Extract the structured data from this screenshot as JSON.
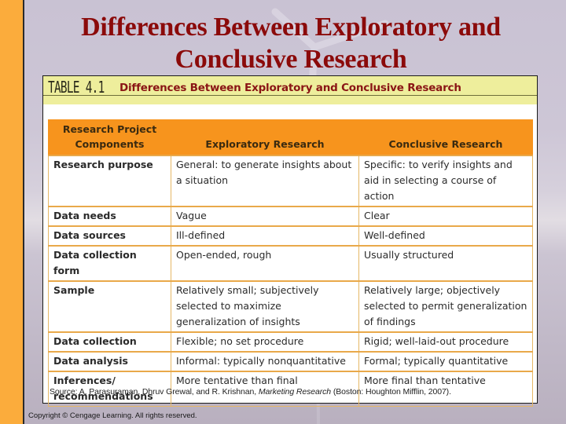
{
  "slide": {
    "title_line1": "Differences Between Exploratory and",
    "title_line2": "Conclusive Research",
    "copyright": "Copyright © Cengage Learning.  All rights reserved."
  },
  "figure": {
    "label": "TABLE 4.1",
    "caption": "Differences Between Exploratory and Conclusive Research",
    "source_prefix": "Source: A. Parasuraman, Dhruv Grewal, and R. Krishnan, ",
    "source_title": "Marketing Research",
    "source_suffix": " (Boston: Houghton Mifflin, 2007).",
    "columns": [
      "Research Project Components",
      "Exploratory Research",
      "Conclusive Research"
    ],
    "rows": [
      {
        "component": "Research purpose",
        "exploratory": "General: to generate insights about a situation",
        "conclusive": "Specific: to verify insights and aid in selecting a course of action"
      },
      {
        "component": "Data needs",
        "exploratory": "Vague",
        "conclusive": "Clear"
      },
      {
        "component": "Data sources",
        "exploratory": "Ill-defined",
        "conclusive": "Well-defined"
      },
      {
        "component": "Data collection form",
        "exploratory": "Open-ended, rough",
        "conclusive": "Usually structured"
      },
      {
        "component": "Sample",
        "exploratory": "Relatively small; subjectively selected to maximize generalization of insights",
        "conclusive": "Relatively large; objectively selected to permit generalization of findings"
      },
      {
        "component": "Data collection",
        "exploratory": "Flexible; no set procedure",
        "conclusive": "Rigid; well-laid-out procedure"
      },
      {
        "component": "Data analysis",
        "exploratory": "Informal: typically nonquantitative",
        "conclusive": "Formal; typically quantitative"
      },
      {
        "component": "Inferences/ recommendations",
        "exploratory": "More tentative than final",
        "conclusive": "More final than tentative"
      }
    ]
  },
  "colors": {
    "title": "#8b0a0a",
    "side_bar": "#fbac3c",
    "header_fill": "#f7941d",
    "caption_band": "#eeee9c",
    "caption_text": "#8a1515",
    "grid_line": "#e6b866"
  }
}
